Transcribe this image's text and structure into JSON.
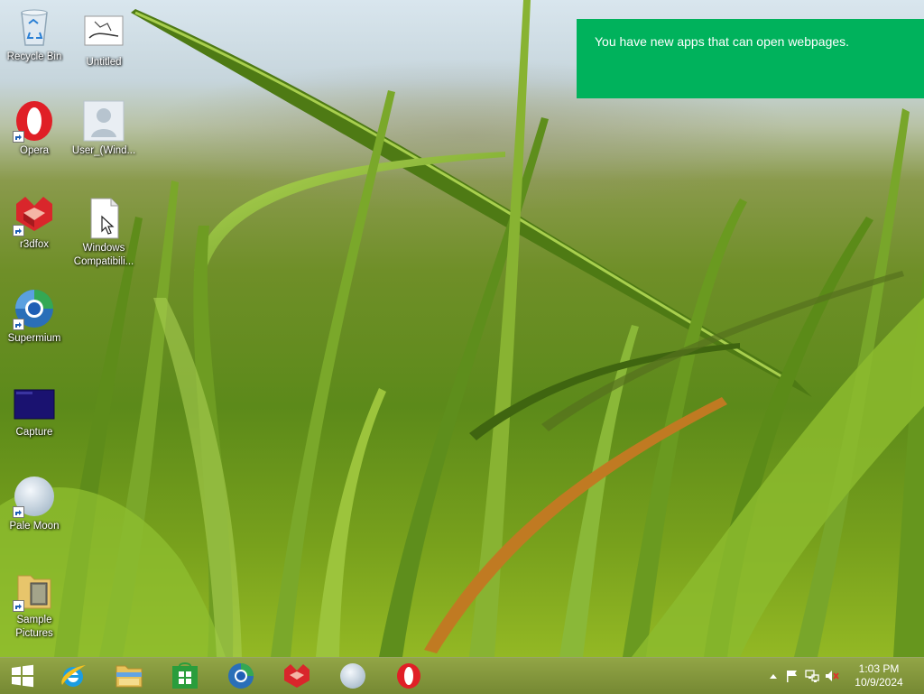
{
  "desktop": {
    "icons": [
      {
        "label": "Recycle Bin",
        "icon": "recycle-bin-icon"
      },
      {
        "label": "Untitled",
        "icon": "image-file-icon"
      },
      {
        "label": "Opera",
        "icon": "opera-icon"
      },
      {
        "label": "User_(Wind...",
        "icon": "user-icon"
      },
      {
        "label": "r3dfox",
        "icon": "r3dfox-icon"
      },
      {
        "label": "Windows Compatibili...",
        "icon": "document-icon"
      },
      {
        "label": "Supermium",
        "icon": "supermium-icon"
      },
      {
        "label": "Capture",
        "icon": "capture-image-icon"
      },
      {
        "label": "Pale Moon",
        "icon": "pale-moon-icon"
      },
      {
        "label": "Sample Pictures",
        "icon": "folder-icon"
      }
    ]
  },
  "toast": {
    "message": "You have new apps that can open webpages.",
    "color": "#00b25c"
  },
  "taskbar": {
    "pinned": [
      {
        "name": "start-button",
        "icon": "windows-logo-icon"
      },
      {
        "name": "internet-explorer",
        "icon": "internet-explorer-icon"
      },
      {
        "name": "file-explorer",
        "icon": "folder-icon"
      },
      {
        "name": "store",
        "icon": "store-icon"
      },
      {
        "name": "supermium",
        "icon": "supermium-icon"
      },
      {
        "name": "r3dfox",
        "icon": "r3dfox-icon"
      },
      {
        "name": "pale-moon",
        "icon": "pale-moon-icon"
      },
      {
        "name": "opera",
        "icon": "opera-icon"
      }
    ],
    "tray": {
      "icons": [
        "chevron-up-icon",
        "flag-icon",
        "network-icon",
        "muted-speaker-icon"
      ],
      "time": "1:03 PM",
      "date": "10/9/2024"
    }
  }
}
